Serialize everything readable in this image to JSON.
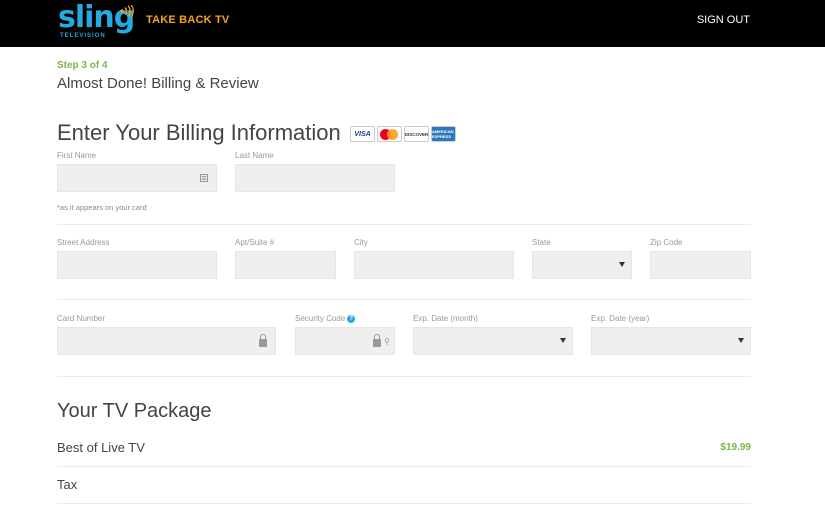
{
  "header": {
    "logo_text": "sling",
    "logo_subtext": "TELEVISION",
    "tagline": "TAKE BACK TV",
    "signout_label": "SIGN OUT",
    "colors": {
      "bar": "#000000",
      "logo": "#27a9e1",
      "tagline": "#f7a21b"
    }
  },
  "step": {
    "label": "Step 3 of 4",
    "title": "Almost Done! Billing & Review"
  },
  "billing": {
    "title": "Enter Your Billing Information",
    "cards": [
      "VISA",
      "MasterCard",
      "DISCOVER",
      "AMERICAN EXPRESS"
    ],
    "first_name_label": "First Name",
    "last_name_label": "Last Name",
    "name_hint": "*as it appears on your card",
    "street_label": "Street Address",
    "apt_label": "Apt/Suite #",
    "city_label": "City",
    "state_label": "State",
    "zip_label": "Zip Code",
    "card_number_label": "Card Number",
    "security_code_label": "Security Code",
    "exp_month_label": "Exp. Date (month)",
    "exp_year_label": "Exp. Date (year)"
  },
  "package": {
    "title": "Your TV Package",
    "rows": [
      {
        "name": "Best of Live TV",
        "price": "$19.99"
      },
      {
        "name": "Tax",
        "price": ""
      }
    ],
    "price_color": "#7ab648"
  },
  "accent": "#7ab648"
}
